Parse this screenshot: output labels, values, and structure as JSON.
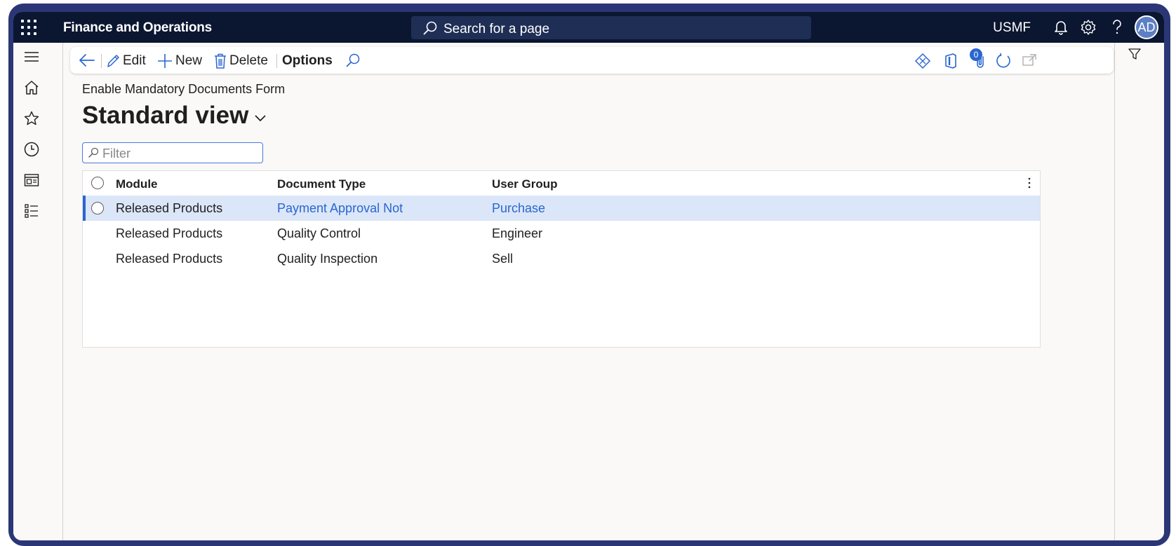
{
  "topbar": {
    "app_title": "Finance and Operations",
    "search_placeholder": "Search for a page",
    "company": "USMF",
    "avatar_initials": "AD"
  },
  "leftnav": {
    "items": [
      "menu-icon",
      "home-icon",
      "favorites-star-icon",
      "recent-clock-icon",
      "workspaces-icon",
      "modules-list-icon"
    ]
  },
  "actionpane": {
    "edit_label": "Edit",
    "new_label": "New",
    "delete_label": "Delete",
    "options_label": "Options",
    "attachments_count": "0"
  },
  "page": {
    "caption": "Enable Mandatory Documents Form",
    "view_name": "Standard view",
    "filter_placeholder": "Filter"
  },
  "grid": {
    "columns": [
      "Module",
      "Document Type",
      "User Group"
    ],
    "rows": [
      {
        "module": "Released Products",
        "document_type": "Payment Approval Not",
        "user_group": "Purchase",
        "selected": true
      },
      {
        "module": "Released Products",
        "document_type": "Quality Control",
        "user_group": "Engineer",
        "selected": false
      },
      {
        "module": "Released Products",
        "document_type": "Quality Inspection",
        "user_group": "Sell",
        "selected": false
      }
    ]
  },
  "colors": {
    "topbar": "#0b1631",
    "accent": "#2a66d0",
    "selected_row": "#dbe6f8",
    "frame": "#2b3676"
  }
}
